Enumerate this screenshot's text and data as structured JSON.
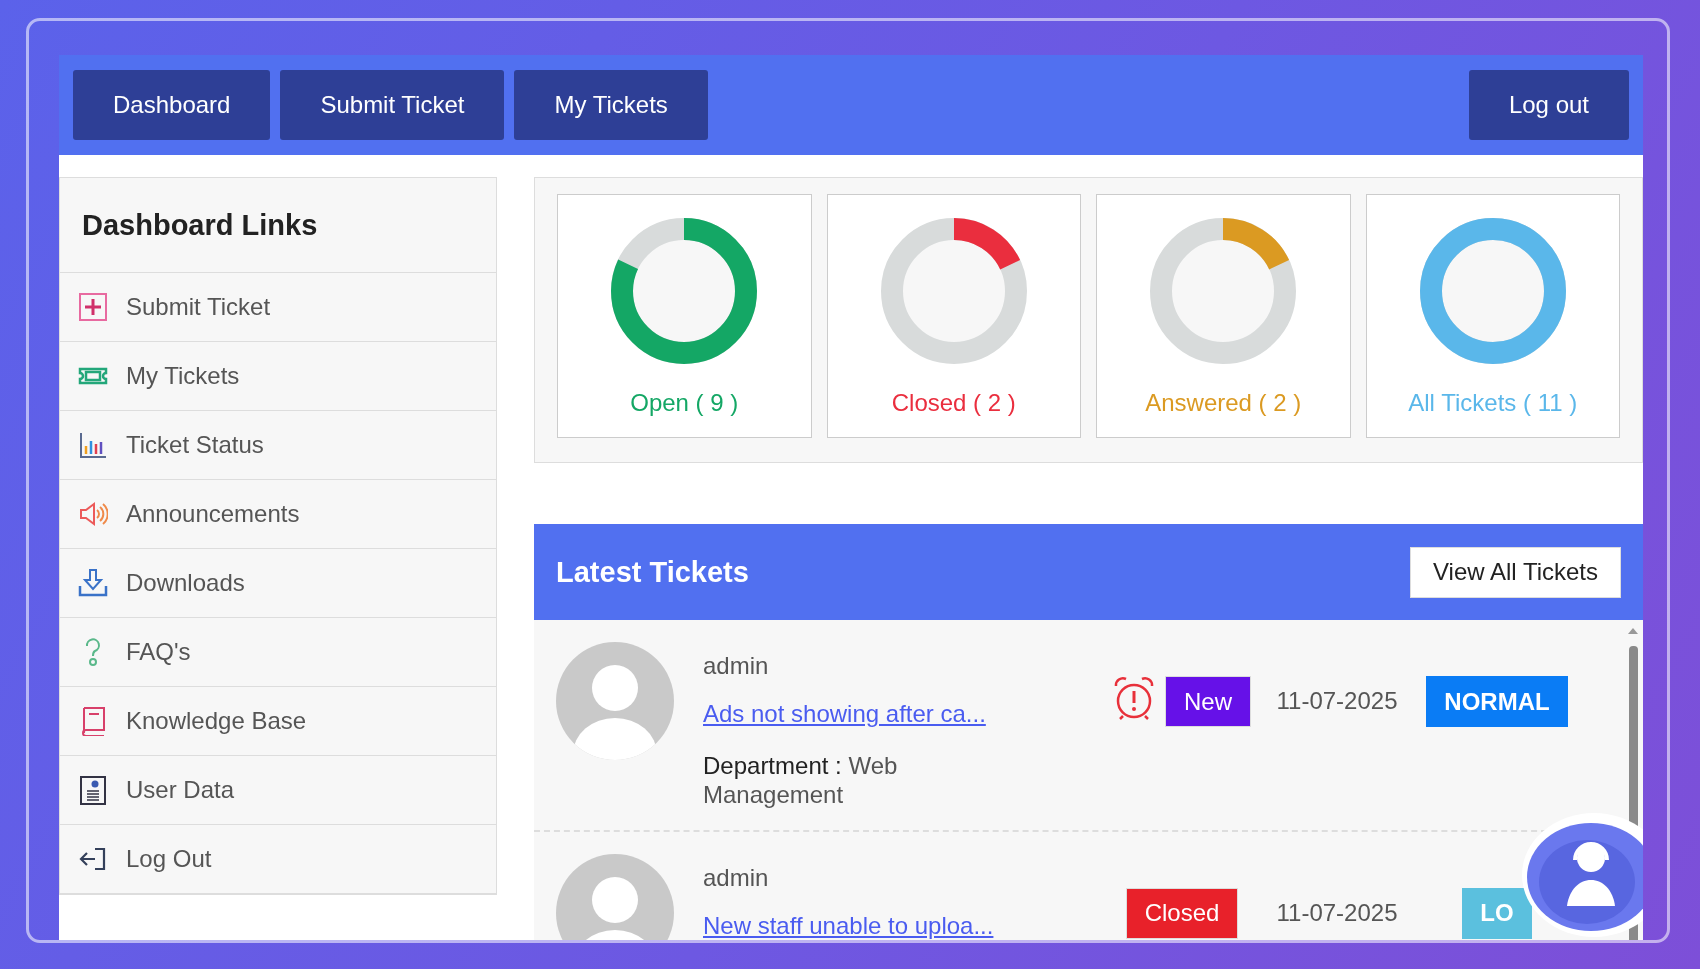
{
  "nav": {
    "buttons": [
      "Dashboard",
      "Submit Ticket",
      "My Tickets"
    ],
    "logout": "Log out"
  },
  "sidebar": {
    "title": "Dashboard Links",
    "items": [
      {
        "label": "Submit Ticket",
        "kind": "plus"
      },
      {
        "label": "My Tickets",
        "kind": "ticket"
      },
      {
        "label": "Ticket Status",
        "kind": "chart"
      },
      {
        "label": "Announcements",
        "kind": "speaker"
      },
      {
        "label": "Downloads",
        "kind": "download"
      },
      {
        "label": "FAQ's",
        "kind": "question"
      },
      {
        "label": "Knowledge Base",
        "kind": "book"
      },
      {
        "label": "User Data",
        "kind": "user"
      },
      {
        "label": "Log Out",
        "kind": "logout"
      }
    ]
  },
  "stats": [
    {
      "label": "Open ( 9 )",
      "level": 0.82,
      "color": "#14a765"
    },
    {
      "label": "Closed ( 2 )",
      "level": 0.18,
      "color": "#ea2e3e"
    },
    {
      "label": "Answered ( 2 )",
      "level": 0.18,
      "color": "#db9a22"
    },
    {
      "label": "All Tickets ( 11 )",
      "level": 1,
      "color": "#5ab7ea"
    }
  ],
  "latest": {
    "title": "Latest Tickets",
    "button": "View All Tickets",
    "tickets": [
      {
        "author": "admin",
        "subject": "Ads not showing after ca...",
        "department_label": "Department :",
        "department": "Web Management",
        "alarm": true,
        "status": {
          "text": "New",
          "color": "#6611e8"
        },
        "date": "11-07-2025",
        "priority": {
          "text": "NORMAL",
          "color": "#0a7cf5"
        }
      },
      {
        "author": "admin",
        "subject": "New staff unable to uploa...",
        "alarm": false,
        "status": {
          "text": "Closed",
          "color": "#e8212a"
        },
        "date": "11-07-2025",
        "priority": {
          "text": "LO",
          "color": "#5bc0de"
        }
      }
    ]
  }
}
